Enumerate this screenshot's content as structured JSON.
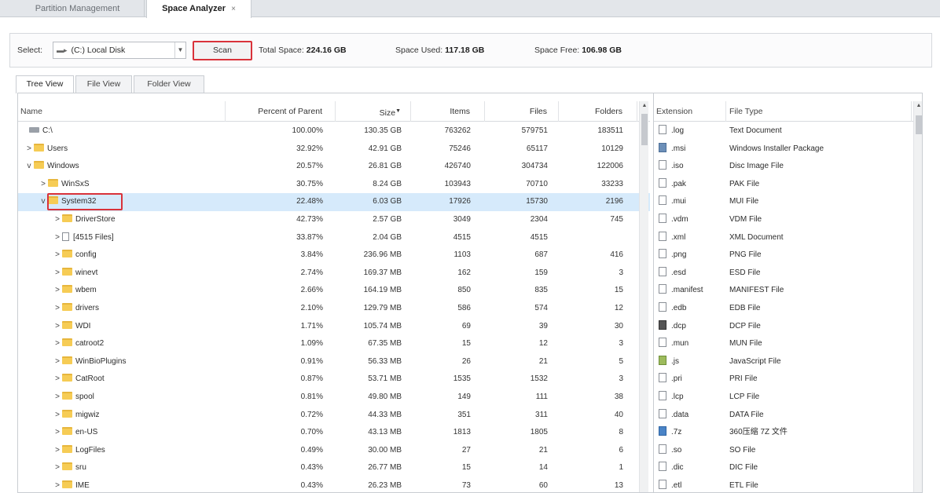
{
  "top_tabs": [
    {
      "label": "Partition Management"
    },
    {
      "label": "Space Analyzer",
      "close": "×"
    }
  ],
  "toolbar": {
    "select_label": "Select:",
    "drive_value": "(C:) Local Disk",
    "scan_label": "Scan",
    "total_label": "Total Space:",
    "total_value": "224.16 GB",
    "used_label": "Space Used:",
    "used_value": "117.18 GB",
    "free_label": "Space Free:",
    "free_value": "106.98 GB"
  },
  "view_tabs": [
    "Tree View",
    "File View",
    "Folder View"
  ],
  "tree": {
    "columns": [
      "Name",
      "Percent of Parent",
      "Size",
      "Items",
      "Files",
      "Folders"
    ],
    "rows": [
      {
        "name": "C:\\",
        "pct": "100.00%",
        "size": "130.35 GB",
        "items": "763262",
        "files": "579751",
        "folders": "183511",
        "icon": "drive",
        "level": 0,
        "expander": ""
      },
      {
        "name": "Users",
        "pct": "32.92%",
        "size": "42.91 GB",
        "items": "75246",
        "files": "65117",
        "folders": "10129",
        "icon": "folder",
        "level": 1,
        "expander": ">"
      },
      {
        "name": "Windows",
        "pct": "20.57%",
        "size": "26.81 GB",
        "items": "426740",
        "files": "304734",
        "folders": "122006",
        "icon": "folder",
        "level": 1,
        "expander": "v"
      },
      {
        "name": "WinSxS",
        "pct": "30.75%",
        "size": "8.24 GB",
        "items": "103943",
        "files": "70710",
        "folders": "33233",
        "icon": "folder",
        "level": 2,
        "expander": ">"
      },
      {
        "name": "System32",
        "pct": "22.48%",
        "size": "6.03 GB",
        "items": "17926",
        "files": "15730",
        "folders": "2196",
        "icon": "folder",
        "level": 2,
        "expander": "v",
        "selected": true
      },
      {
        "name": "DriverStore",
        "pct": "42.73%",
        "size": "2.57 GB",
        "items": "3049",
        "files": "2304",
        "folders": "745",
        "icon": "folder",
        "level": 3,
        "expander": ">"
      },
      {
        "name": "[4515 Files]",
        "pct": "33.87%",
        "size": "2.04 GB",
        "items": "4515",
        "files": "4515",
        "folders": "",
        "icon": "file",
        "level": 3,
        "expander": ">"
      },
      {
        "name": "config",
        "pct": "3.84%",
        "size": "236.96 MB",
        "items": "1103",
        "files": "687",
        "folders": "416",
        "icon": "folder",
        "level": 3,
        "expander": ">"
      },
      {
        "name": "winevt",
        "pct": "2.74%",
        "size": "169.37 MB",
        "items": "162",
        "files": "159",
        "folders": "3",
        "icon": "folder",
        "level": 3,
        "expander": ">"
      },
      {
        "name": "wbem",
        "pct": "2.66%",
        "size": "164.19 MB",
        "items": "850",
        "files": "835",
        "folders": "15",
        "icon": "folder",
        "level": 3,
        "expander": ">"
      },
      {
        "name": "drivers",
        "pct": "2.10%",
        "size": "129.79 MB",
        "items": "586",
        "files": "574",
        "folders": "12",
        "icon": "folder",
        "level": 3,
        "expander": ">"
      },
      {
        "name": "WDI",
        "pct": "1.71%",
        "size": "105.74 MB",
        "items": "69",
        "files": "39",
        "folders": "30",
        "icon": "folder",
        "level": 3,
        "expander": ">"
      },
      {
        "name": "catroot2",
        "pct": "1.09%",
        "size": "67.35 MB",
        "items": "15",
        "files": "12",
        "folders": "3",
        "icon": "folder",
        "level": 3,
        "expander": ">"
      },
      {
        "name": "WinBioPlugins",
        "pct": "0.91%",
        "size": "56.33 MB",
        "items": "26",
        "files": "21",
        "folders": "5",
        "icon": "folder",
        "level": 3,
        "expander": ">"
      },
      {
        "name": "CatRoot",
        "pct": "0.87%",
        "size": "53.71 MB",
        "items": "1535",
        "files": "1532",
        "folders": "3",
        "icon": "folder",
        "level": 3,
        "expander": ">"
      },
      {
        "name": "spool",
        "pct": "0.81%",
        "size": "49.80 MB",
        "items": "149",
        "files": "111",
        "folders": "38",
        "icon": "folder",
        "level": 3,
        "expander": ">"
      },
      {
        "name": "migwiz",
        "pct": "0.72%",
        "size": "44.33 MB",
        "items": "351",
        "files": "311",
        "folders": "40",
        "icon": "folder",
        "level": 3,
        "expander": ">"
      },
      {
        "name": "en-US",
        "pct": "0.70%",
        "size": "43.13 MB",
        "items": "1813",
        "files": "1805",
        "folders": "8",
        "icon": "folder",
        "level": 3,
        "expander": ">"
      },
      {
        "name": "LogFiles",
        "pct": "0.49%",
        "size": "30.00 MB",
        "items": "27",
        "files": "21",
        "folders": "6",
        "icon": "folder",
        "level": 3,
        "expander": ">"
      },
      {
        "name": "sru",
        "pct": "0.43%",
        "size": "26.77 MB",
        "items": "15",
        "files": "14",
        "folders": "1",
        "icon": "folder",
        "level": 3,
        "expander": ">"
      },
      {
        "name": "IME",
        "pct": "0.43%",
        "size": "26.23 MB",
        "items": "73",
        "files": "60",
        "folders": "13",
        "icon": "folder",
        "level": 3,
        "expander": ">"
      }
    ]
  },
  "extensions": {
    "columns": [
      "Extension",
      "File Type"
    ],
    "rows": [
      {
        "ext": ".log",
        "type": "Text Document",
        "icon": "file"
      },
      {
        "ext": ".msi",
        "type": "Windows Installer Package",
        "icon": "b"
      },
      {
        "ext": ".iso",
        "type": "Disc Image File",
        "icon": "file"
      },
      {
        "ext": ".pak",
        "type": "PAK File",
        "icon": "file"
      },
      {
        "ext": ".mui",
        "type": "MUI File",
        "icon": "file"
      },
      {
        "ext": ".vdm",
        "type": "VDM File",
        "icon": "file"
      },
      {
        "ext": ".xml",
        "type": "XML Document",
        "icon": "file"
      },
      {
        "ext": ".png",
        "type": "PNG File",
        "icon": "file"
      },
      {
        "ext": ".esd",
        "type": "ESD File",
        "icon": "file"
      },
      {
        "ext": ".manifest",
        "type": "MANIFEST File",
        "icon": "file"
      },
      {
        "ext": ".edb",
        "type": "EDB File",
        "icon": "file"
      },
      {
        "ext": ".dcp",
        "type": "DCP File",
        "icon": "d"
      },
      {
        "ext": ".mun",
        "type": "MUN File",
        "icon": "file"
      },
      {
        "ext": ".js",
        "type": "JavaScript File",
        "icon": "g"
      },
      {
        "ext": ".pri",
        "type": "PRI File",
        "icon": "file"
      },
      {
        "ext": ".lcp",
        "type": "LCP File",
        "icon": "file"
      },
      {
        "ext": ".data",
        "type": "DATA File",
        "icon": "file"
      },
      {
        "ext": ".7z",
        "type": "360压缩 7Z 文件",
        "icon": "c"
      },
      {
        "ext": ".so",
        "type": "SO File",
        "icon": "file"
      },
      {
        "ext": ".dic",
        "type": "DIC File",
        "icon": "file"
      },
      {
        "ext": ".etl",
        "type": "ETL File",
        "icon": "file"
      }
    ]
  }
}
